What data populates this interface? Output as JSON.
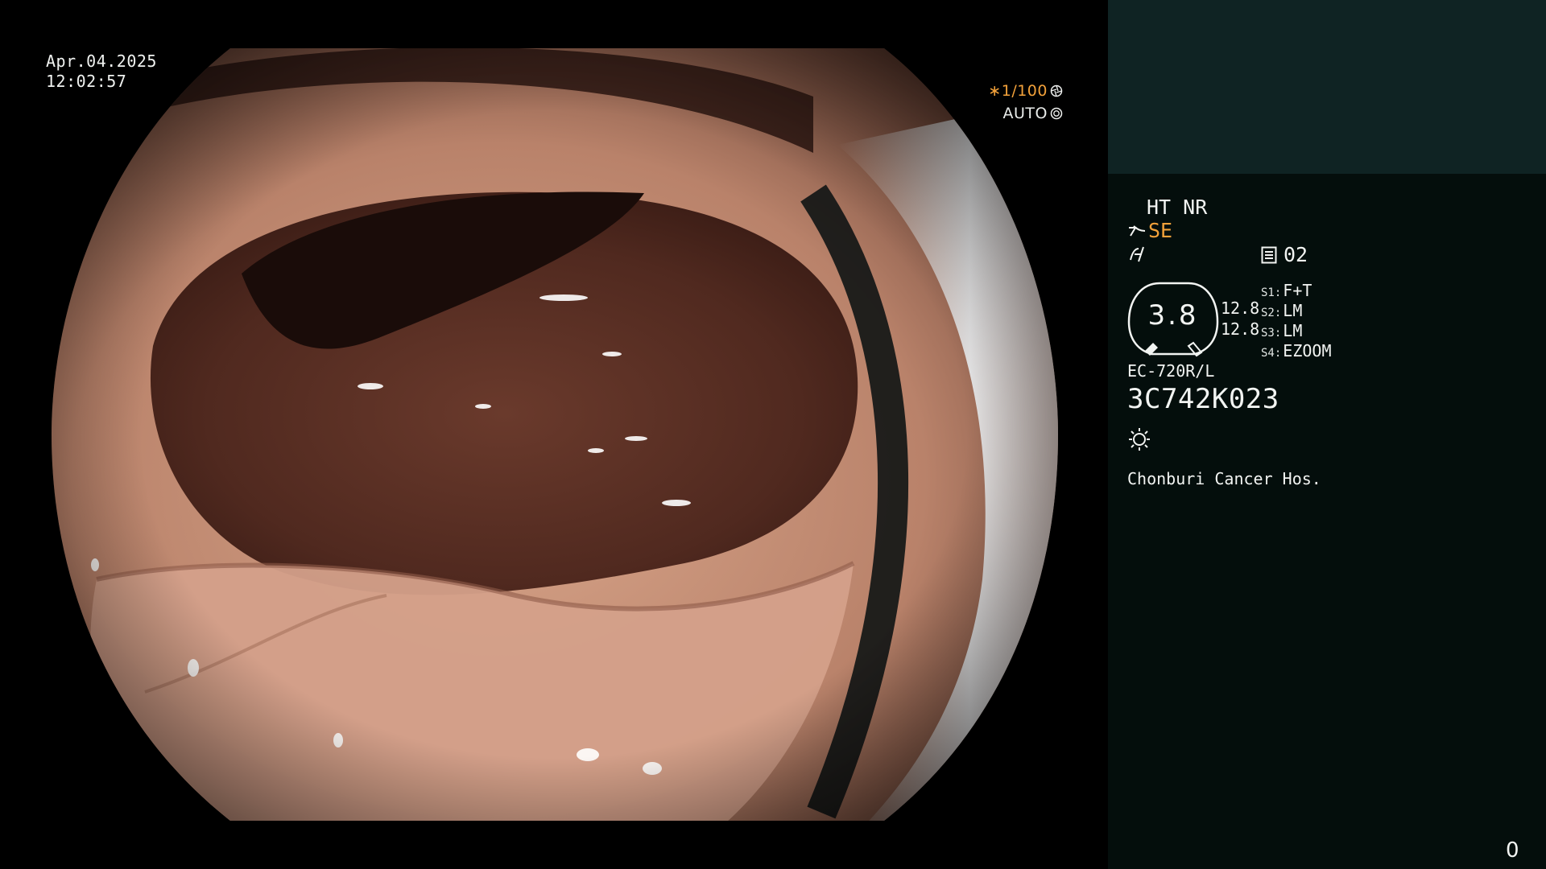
{
  "video": {
    "date": "Apr.04.2025",
    "time": "12:02:57",
    "shutter": "∗1/100",
    "iris": "AUTO"
  },
  "panel": {
    "modes": "HT NR",
    "enhance": "SE",
    "memory": "02",
    "dial_value": "3.8",
    "zoom_a": "12.8",
    "zoom_b": "12.8",
    "switches": [
      {
        "key": "S1:",
        "value": "F+T"
      },
      {
        "key": "S2:",
        "value": "LM"
      },
      {
        "key": "S3:",
        "value": "LM"
      },
      {
        "key": "S4:",
        "value": "EZOOM"
      }
    ],
    "scope_model": "EC-720R/L",
    "serial": "3C742K023",
    "hospital": "Chonburi Cancer Hos.",
    "frame_count": "0"
  },
  "colors": {
    "accent": "#f2a13a",
    "panel_top": "#0f2323",
    "panel": "#040e0c"
  }
}
